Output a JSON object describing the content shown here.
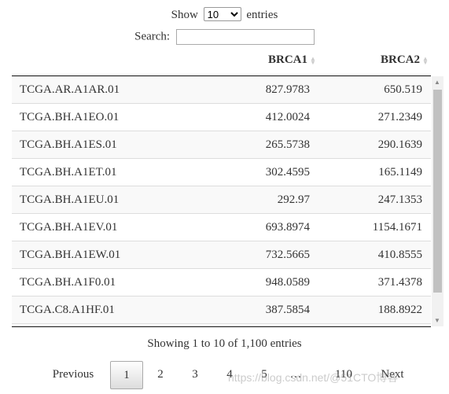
{
  "length": {
    "show": "Show",
    "value": "10",
    "entries": "entries"
  },
  "search": {
    "label": "Search:",
    "value": ""
  },
  "columns": [
    "",
    "BRCA1",
    "BRCA2"
  ],
  "rows": [
    [
      "TCGA.AR.A1AR.01",
      "827.9783",
      "650.519"
    ],
    [
      "TCGA.BH.A1EO.01",
      "412.0024",
      "271.2349"
    ],
    [
      "TCGA.BH.A1ES.01",
      "265.5738",
      "290.1639"
    ],
    [
      "TCGA.BH.A1ET.01",
      "302.4595",
      "165.1149"
    ],
    [
      "TCGA.BH.A1EU.01",
      "292.97",
      "247.1353"
    ],
    [
      "TCGA.BH.A1EV.01",
      "693.8974",
      "1154.1671"
    ],
    [
      "TCGA.BH.A1EW.01",
      "732.5665",
      "410.8555"
    ],
    [
      "TCGA.BH.A1F0.01",
      "948.0589",
      "371.4378"
    ],
    [
      "TCGA.C8.A1HF.01",
      "387.5854",
      "188.8922"
    ]
  ],
  "info": "Showing 1 to 10 of 1,100 entries",
  "pagination": {
    "previous": "Previous",
    "pages": [
      "1",
      "2",
      "3",
      "4",
      "5",
      "…",
      "110"
    ],
    "current": "1",
    "next": "Next"
  },
  "watermark": "https://blog.csdn.net/@51CTO博客"
}
